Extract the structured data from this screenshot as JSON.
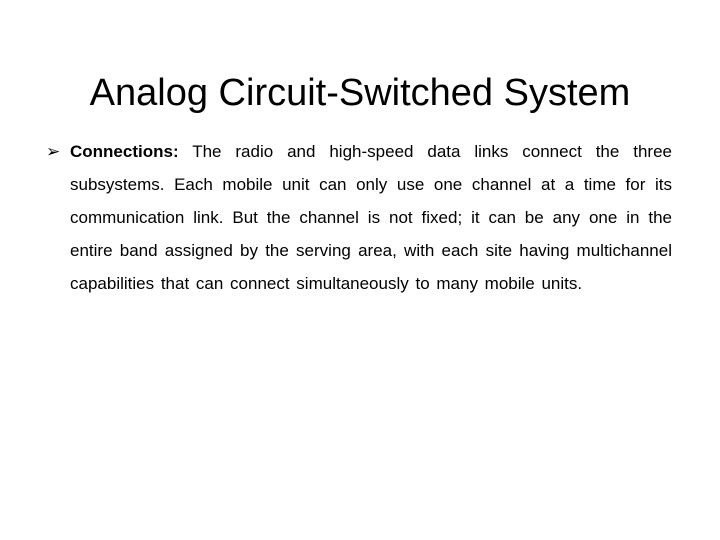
{
  "slide": {
    "title": "Analog Circuit-Switched System",
    "bullets": [
      {
        "icon": "arrow-bullet-icon",
        "glyph": "➢",
        "label": "Connections:",
        "text": " The radio and high-speed data links connect the three subsystems. Each mobile unit can only use one channel at a time for its communication link. But the channel is not fixed; it can be any one in the entire band assigned by the serving area, with each site having multichannel capabilities that can connect simultaneously to many mobile units."
      }
    ]
  }
}
